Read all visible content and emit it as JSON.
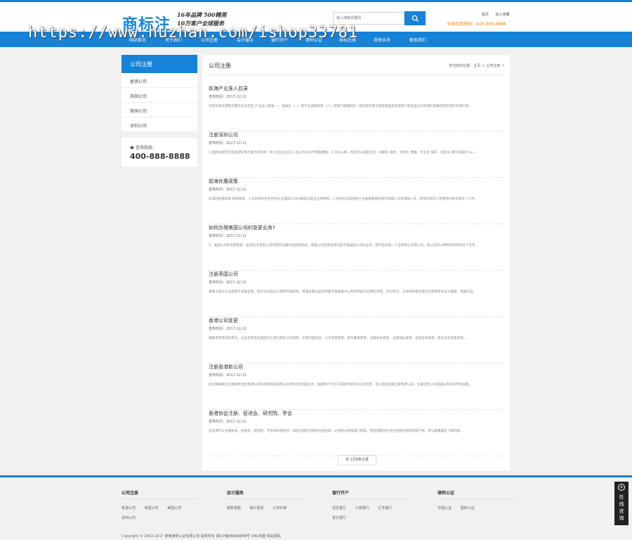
{
  "header": {
    "logo": "商标注",
    "slogan_line1": "16年品牌 500精英",
    "slogan_line2": "10万客户全球服务",
    "search_placeholder": "输入搜索关键词",
    "top_links": [
      "首页",
      "加入收藏"
    ],
    "hotline": "全国咨询热线：400-888-8888"
  },
  "watermark": "https://www.huzhan.com/ishop33781",
  "nav": {
    "items": [
      "网站首页",
      "关于我们",
      "公司注册",
      "会计服务",
      "银行开户",
      "律师公证",
      "商标注册",
      "其他业务",
      "联系我们"
    ]
  },
  "sidebar": {
    "title": "公司注册",
    "items": [
      "香港公司",
      "英国公司",
      "美国公司",
      "深圳公司"
    ],
    "hotline_label": "咨询热线：",
    "hotline_number": "400-888-8888"
  },
  "main": {
    "title": "公司注册",
    "breadcrumb": "您当前的位置：主页 ＞ 公司注册 ＞",
    "articles": [
      {
        "title": "前海产业准入目录",
        "date": "发布时间：2017-12-11",
        "summary": "深圳前海深港现代服务业合作区 产业准入目录 一、金融业（一）银行业金融机构（二）非银行金融机构（包括但不限于经银保监会监管部门批准设立的非银行金融机构及境外非银行金..."
      },
      {
        "title": "注册深圳公司",
        "date": "发布时间：2017-12-11",
        "summary": "1.国际化城市打造品牌形象之概念有优势（中小型企业只在人在以万以内不需要缴税）3.可以从事，包括可以取集企业：规模化 服务：综合化 营销：专业化 操作：流程化 我们的服务 Ser..."
      },
      {
        "title": "前海优惠政策",
        "date": "发布时间：2017-12-11",
        "summary": "前海的优惠政策 财税政策：1.对前海符合条件的企业减按15%的税率征收企业所得税；2.对符合前海规划产业发展需要的境外高端人才和紧缺人才，取得深圳市人民政府内地与境外个人所..."
      },
      {
        "title": "如何办理美国公司的变更业务?",
        "date": "发布时间：2017-12-11",
        "summary": "1、美国公司的名称变更：是指在于改变公司的现有注册的名称的形式，美国公司变更名称只是不再描述公司的业务，而不是创成一个全新的公司或公司，新公司可以用简单的修改这个名字..."
      },
      {
        "title": "注册英国公司",
        "date": "发布时间：2017-12-11",
        "summary": "英属大部分立法适用于英属全境，但司法也独立于政府行政机构。英属位数也是世界最丰富金融中心和世界最大的保险市场。作为经济，法律体系相为发达的老牌资本主义国家，英属的自..."
      },
      {
        "title": "香港公司变更",
        "date": "发布时间：2017-12-11",
        "summary": "随着市场情况的变化，企业在完成注册后可以须当变更公司资料，主要内容包括：公司名称变更，股东董事变更，注册资本变更，注册地址变更，法定秘书变更，股份证号等变更等。..."
      },
      {
        "title": "注册香港新公司",
        "date": "发布时间：2017-12-11",
        "summary": "盈达厚辞股东主要提供全新香港公司和现存现成香港公司2种主要注册业务，如果客户不急于在短时间内开正式经营，可以选择注册全新香港公司，注册全新公司英国头等开始申请办理..."
      },
      {
        "title": "香港协会注册、促进会、研究院、学会",
        "date": "发布时间：2017-12-11",
        "summary": "在香港可以注册协会、促进会、研究院、学会等机构社团，目前在国内注册的社团组织，必须经过民政部门审批，而且国家对社会社团组织控制比较严格，所以越来越较下来的很..."
      }
    ],
    "pager": "共 1页8条记录"
  },
  "footer": {
    "columns": [
      {
        "title": "公司注册",
        "links": [
          "香港公司",
          "英国公司",
          "美国公司",
          "深圳公司"
        ]
      },
      {
        "title": "会计服务",
        "links": [
          "做账报税",
          "审计报告",
          "公司年审"
        ]
      },
      {
        "title": "银行开户",
        "links": [
          "恒生银行",
          "工商银行",
          "汇丰银行",
          "其它银行"
        ]
      },
      {
        "title": "律师公证",
        "links": [
          "中国公证",
          "国际公证"
        ]
      }
    ],
    "copyright": "Copyright © 2002-2017 某某律师公证有限公司 版权所有 湘ICP备88888888号 XML地图 网站源码"
  },
  "online": {
    "label": "在线咨询"
  }
}
